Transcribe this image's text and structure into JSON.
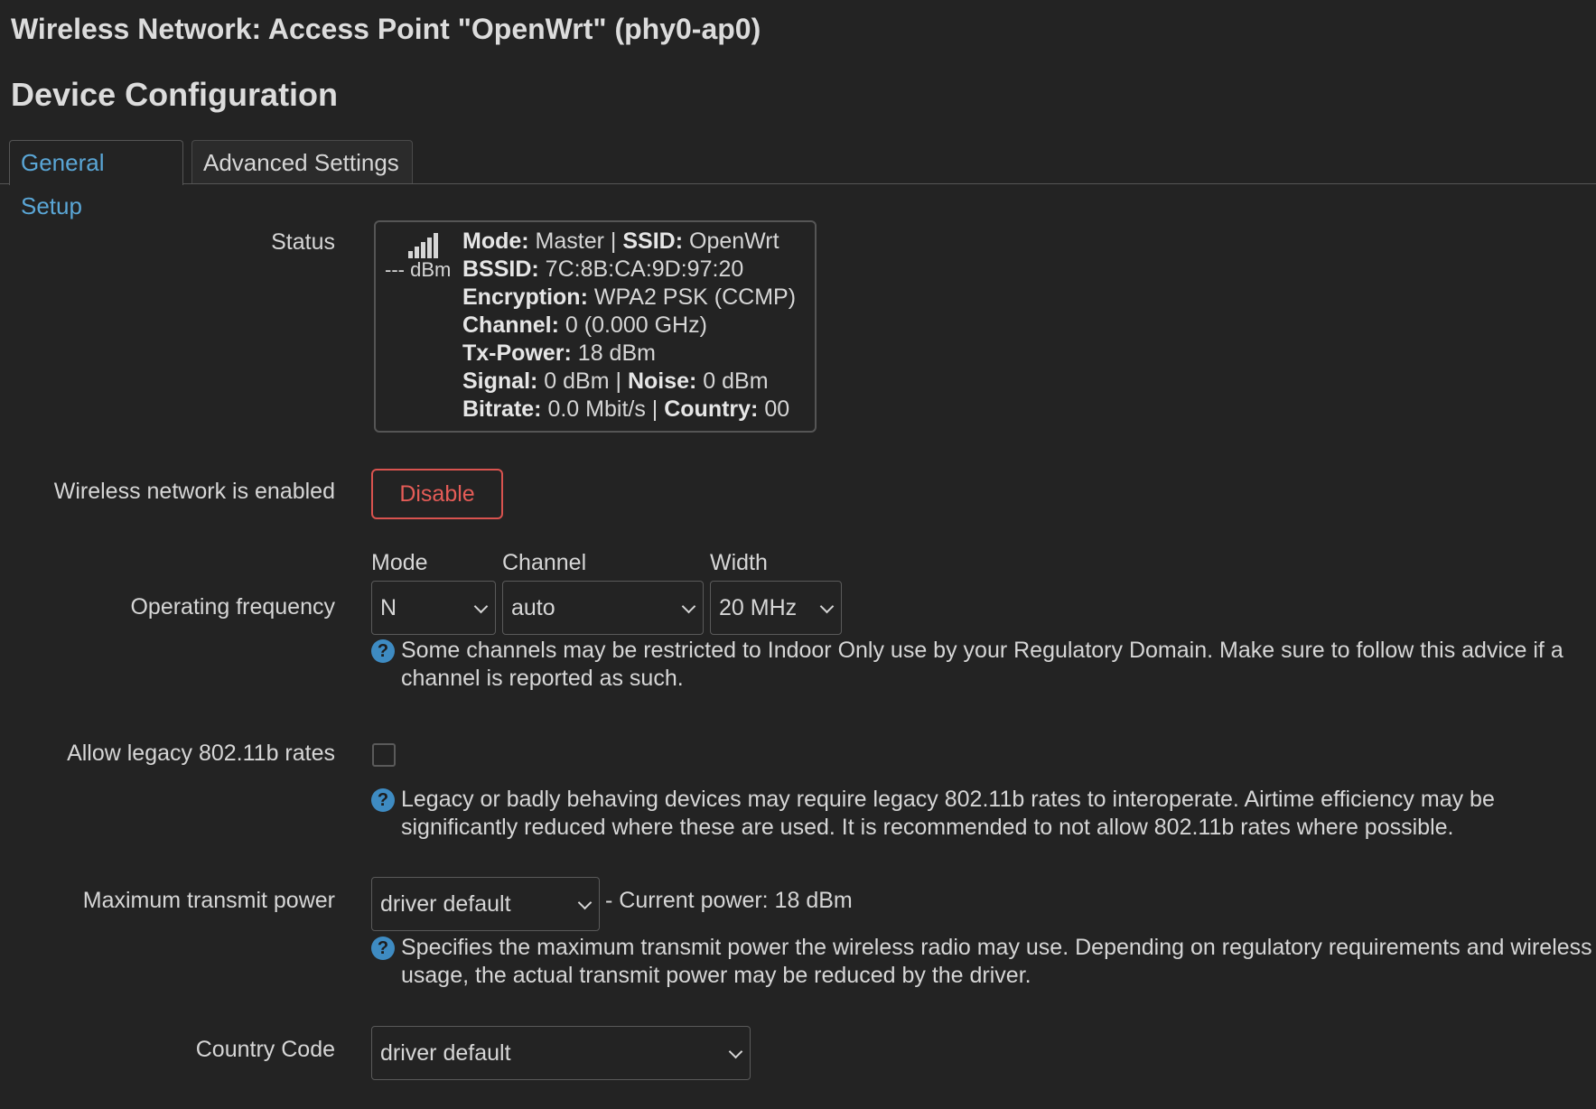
{
  "page": {
    "title": "Wireless Network: Access Point \"OpenWrt\" (phy0-ap0)",
    "section": "Device Configuration"
  },
  "tabs": [
    {
      "label": "General Setup",
      "active": true
    },
    {
      "label": "Advanced Settings",
      "active": false
    }
  ],
  "status": {
    "label": "Status",
    "signal_icon": "signal-strength-icon",
    "dbm": "--- dBm",
    "rows": [
      [
        {
          "k": "Mode:",
          "v": " Master | "
        },
        {
          "k": "SSID:",
          "v": " OpenWrt"
        }
      ],
      [
        {
          "k": "BSSID:",
          "v": " 7C:8B:CA:9D:97:20"
        }
      ],
      [
        {
          "k": "Encryption:",
          "v": " WPA2 PSK (CCMP)"
        }
      ],
      [
        {
          "k": "Channel:",
          "v": " 0 (0.000 GHz)"
        }
      ],
      [
        {
          "k": "Tx-Power:",
          "v": " 18 dBm"
        }
      ],
      [
        {
          "k": "Signal:",
          "v": " 0 dBm | "
        },
        {
          "k": "Noise:",
          "v": " 0 dBm"
        }
      ],
      [
        {
          "k": "Bitrate:",
          "v": " 0.0 Mbit/s | "
        },
        {
          "k": "Country:",
          "v": " 00"
        }
      ]
    ]
  },
  "enabled": {
    "label": "Wireless network is enabled",
    "button": "Disable"
  },
  "frequency": {
    "label": "Operating frequency",
    "mode_label": "Mode",
    "mode_value": "N",
    "channel_label": "Channel",
    "channel_value": "auto",
    "width_label": "Width",
    "width_value": "20 MHz",
    "help": "Some channels may be restricted to Indoor Only use by your Regulatory Domain. Make sure to follow this advice if a channel is reported as such."
  },
  "legacy": {
    "label": "Allow legacy 802.11b rates",
    "checked": false,
    "help": "Legacy or badly behaving devices may require legacy 802.11b rates to interoperate. Airtime efficiency may be significantly reduced where these are used. It is recommended to not allow 802.11b rates where possible."
  },
  "txpower": {
    "label": "Maximum transmit power",
    "value": "driver default",
    "current": "- Current power: 18 dBm",
    "help": "Specifies the maximum transmit power the wireless radio may use. Depending on regulatory requirements and wireless usage, the actual transmit power may be reduced by the driver."
  },
  "country": {
    "label": "Country Code",
    "value": "driver default"
  },
  "colors": {
    "background": "#232323",
    "accent": "#5aa6d6",
    "danger": "#d9534f",
    "help_icon": "#3e8bc2"
  }
}
